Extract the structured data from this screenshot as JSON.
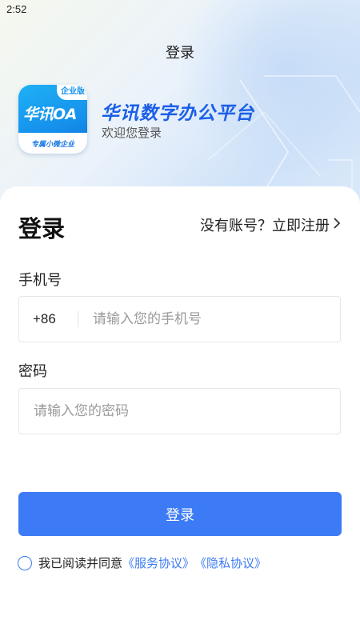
{
  "status_bar": {
    "time": "2:52"
  },
  "nav": {
    "title": "登录"
  },
  "brand": {
    "logo_text": "华讯OA",
    "logo_badge": "企业版",
    "logo_subtitle": "专属小微企业",
    "app_name": "华讯数字办公平台",
    "welcome": "欢迎您登录"
  },
  "form": {
    "heading": "登录",
    "register_link": "没有账号？立即注册",
    "phone_label": "手机号",
    "country_code": "+86",
    "phone_placeholder": "请输入您的手机号",
    "password_label": "密码",
    "password_placeholder": "请输入您的密码",
    "submit_label": "登录"
  },
  "agreement": {
    "prefix": "我已阅读并同意",
    "service_link": "《服务协议》",
    "privacy_link": "《隐私协议》"
  },
  "colors": {
    "accent": "#3c7bf5",
    "brand_blue": "#1b5fe8"
  }
}
